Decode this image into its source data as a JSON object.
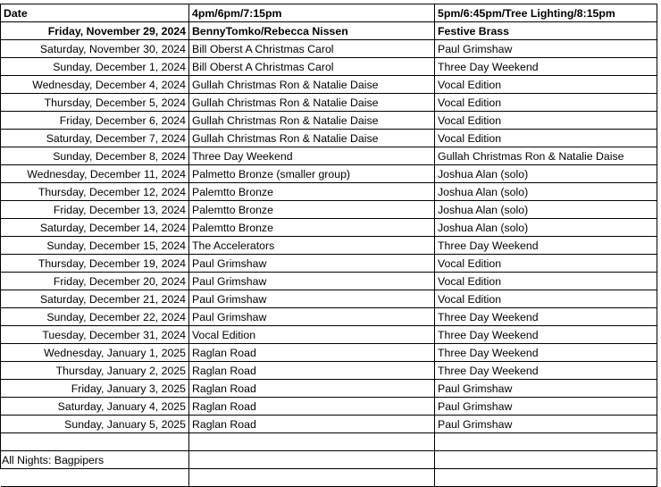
{
  "table": {
    "columns": [
      {
        "key": "date",
        "label": "Date"
      },
      {
        "key": "early",
        "label": "4pm/6pm/7:15pm"
      },
      {
        "key": "late",
        "label": "5pm/6:45pm/Tree Lighting/8:15pm"
      }
    ],
    "rows": [
      {
        "date": "Friday, November 29, 2024",
        "early": "BennyTomko/Rebecca Nissen",
        "late": "Festive Brass",
        "bold": true
      },
      {
        "date": "Saturday, November 30, 2024",
        "early": "Bill Oberst A Christmas Carol",
        "late": "Paul Grimshaw",
        "bold": false
      },
      {
        "date": "Sunday, December 1, 2024",
        "early": "Bill Oberst A Christmas Carol",
        "late": "Three Day Weekend",
        "bold": false
      },
      {
        "date": "Wednesday, December 4, 2024",
        "early": "Gullah Christmas Ron & Natalie Daise",
        "late": "Vocal Edition",
        "bold": false
      },
      {
        "date": "Thursday, December 5, 2024",
        "early": "Gullah Christmas Ron & Natalie Daise",
        "late": "Vocal Edition",
        "bold": false
      },
      {
        "date": "Friday, December 6, 2024",
        "early": "Gullah Christmas Ron & Natalie Daise",
        "late": "Vocal Edition",
        "bold": false
      },
      {
        "date": "Saturday, December 7, 2024",
        "early": "Gullah Christmas Ron & Natalie Daise",
        "late": "Vocal Edition",
        "bold": false
      },
      {
        "date": "Sunday, December 8, 2024",
        "early": "Three Day Weekend",
        "late": "Gullah Christmas Ron & Natalie Daise",
        "bold": false
      },
      {
        "date": "Wednesday, December 11, 2024",
        "early": "Palmetto Bronze (smaller group)",
        "late": "Joshua Alan (solo)",
        "bold": false
      },
      {
        "date": "Thursday, December 12, 2024",
        "early": "Palemtto Bronze",
        "late": "Joshua Alan (solo)",
        "bold": false
      },
      {
        "date": "Friday, December 13, 2024",
        "early": "Palemtto Bronze",
        "late": "Joshua Alan (solo)",
        "bold": false
      },
      {
        "date": "Saturday, December 14, 2024",
        "early": "Palemtto Bronze",
        "late": "Joshua Alan (solo)",
        "bold": false
      },
      {
        "date": "Sunday, December 15, 2024",
        "early": "The Accelerators",
        "late": "Three Day Weekend",
        "bold": false
      },
      {
        "date": "Thursday, December 19, 2024",
        "early": "Paul Grimshaw",
        "late": "Vocal Edition",
        "bold": false
      },
      {
        "date": "Friday, December 20, 2024",
        "early": "Paul Grimshaw",
        "late": "Vocal Edition",
        "bold": false
      },
      {
        "date": "Saturday, December 21, 2024",
        "early": "Paul Grimshaw",
        "late": "Vocal Edition",
        "bold": false
      },
      {
        "date": "Sunday, December 22, 2024",
        "early": "Paul Grimshaw",
        "late": "Three Day Weekend",
        "bold": false
      },
      {
        "date": "Tuesday, December 31, 2024",
        "early": "Vocal Edition",
        "late": "Three Day Weekend",
        "bold": false
      },
      {
        "date": "Wednesday, January 1, 2025",
        "early": "Raglan Road",
        "late": "Three Day Weekend",
        "bold": false
      },
      {
        "date": "Thursday, January 2, 2025",
        "early": "Raglan Road",
        "late": "Three Day Weekend",
        "bold": false
      },
      {
        "date": "Friday, January 3, 2025",
        "early": "Raglan Road",
        "late": "Paul Grimshaw",
        "bold": false
      },
      {
        "date": "Saturday, January 4, 2025",
        "early": "Raglan Road",
        "late": "Paul Grimshaw",
        "bold": false
      },
      {
        "date": "Sunday, January 5, 2025",
        "early": "Raglan Road",
        "late": "Paul Grimshaw",
        "bold": false
      },
      {
        "date": "",
        "early": "",
        "late": "",
        "bold": false
      },
      {
        "date": "All Nights: Bagpipers",
        "early": "",
        "late": "",
        "bold": false,
        "left": true
      },
      {
        "date": "",
        "early": "",
        "late": "",
        "bold": false,
        "tail": true
      }
    ]
  },
  "colors": {
    "grid": "#000000",
    "text": "#000000",
    "background": "#ffffff"
  }
}
